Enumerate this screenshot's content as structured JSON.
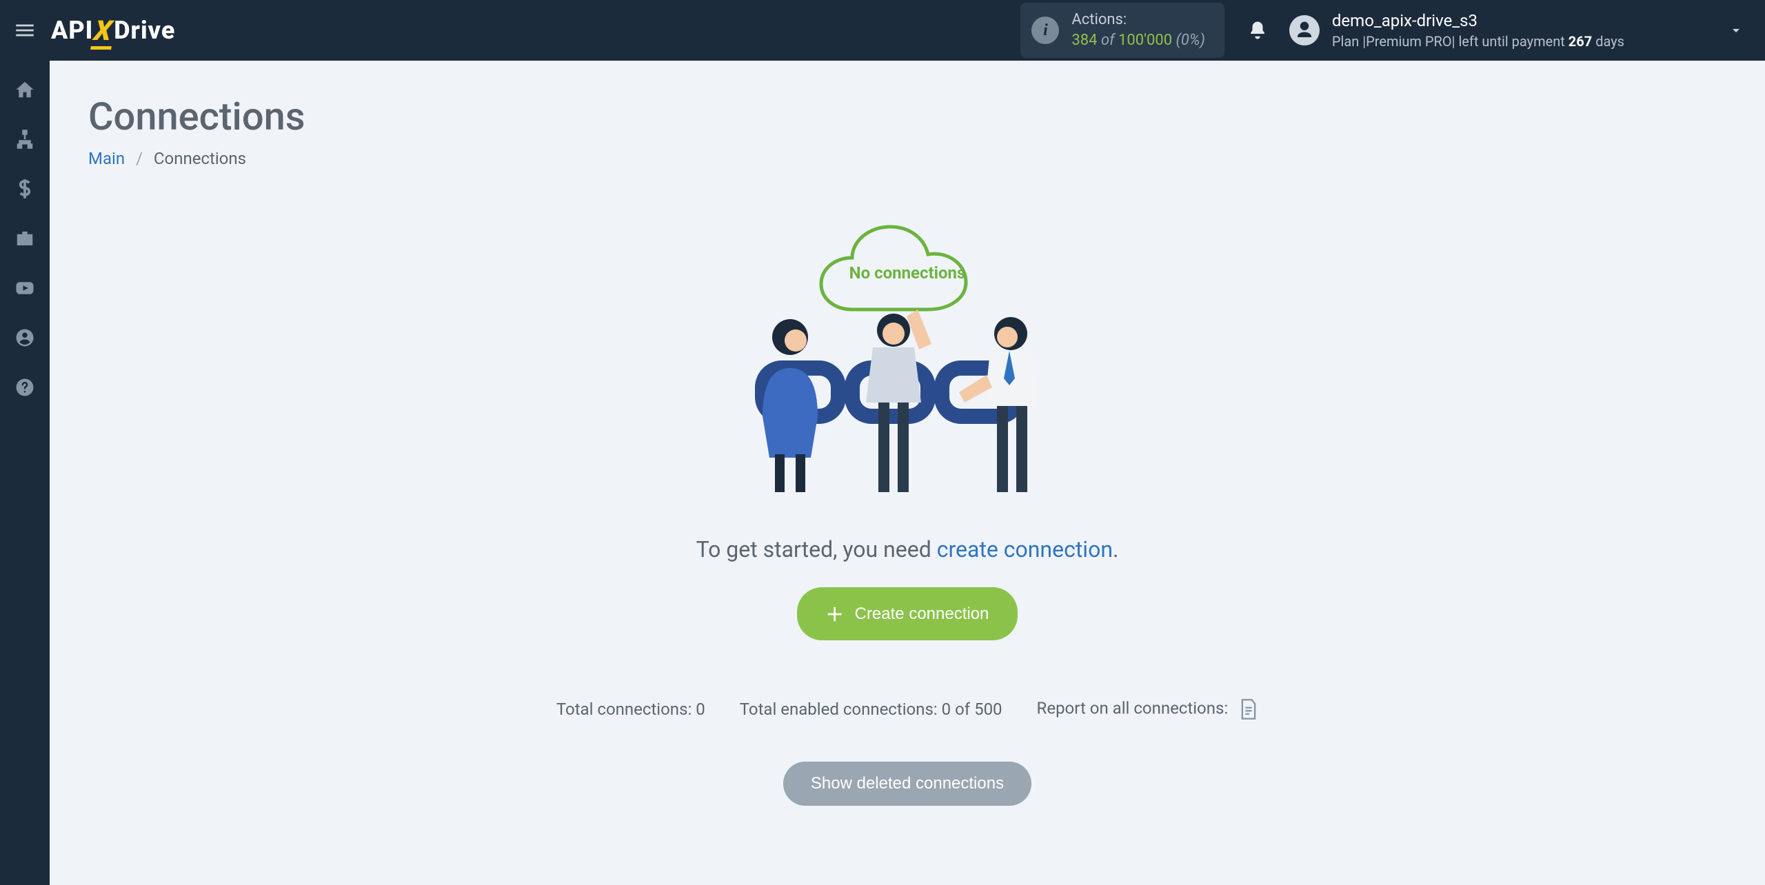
{
  "header": {
    "logo_left": "API",
    "logo_x": "X",
    "logo_right": "Drive",
    "actions": {
      "label": "Actions:",
      "used": "384",
      "of": "of",
      "limit": "100'000",
      "pct": "(0%)"
    },
    "user": {
      "name": "demo_apix-drive_s3",
      "plan_prefix": "Plan |",
      "plan_name": "Premium PRO",
      "plan_sep": "|",
      "plan_tail": " left until payment ",
      "days": "267",
      "days_suffix": " days"
    }
  },
  "sidebar": {
    "items": [
      {
        "name": "home"
      },
      {
        "name": "connections"
      },
      {
        "name": "billing"
      },
      {
        "name": "briefcase"
      },
      {
        "name": "video"
      },
      {
        "name": "account"
      },
      {
        "name": "help"
      }
    ]
  },
  "page": {
    "title": "Connections",
    "breadcrumb": {
      "main": "Main",
      "sep": "/",
      "current": "Connections"
    },
    "illustration_label": "No connections",
    "lead_prefix": "To get started, you need ",
    "lead_link": "create connection",
    "lead_suffix": ".",
    "create_btn": "Create connection",
    "stats": {
      "total_label": "Total connections:",
      "total_value": "0",
      "enabled_label": "Total enabled connections:",
      "enabled_value": "0 of 500",
      "report_label": "Report on all connections:"
    },
    "show_deleted": "Show deleted connections"
  }
}
